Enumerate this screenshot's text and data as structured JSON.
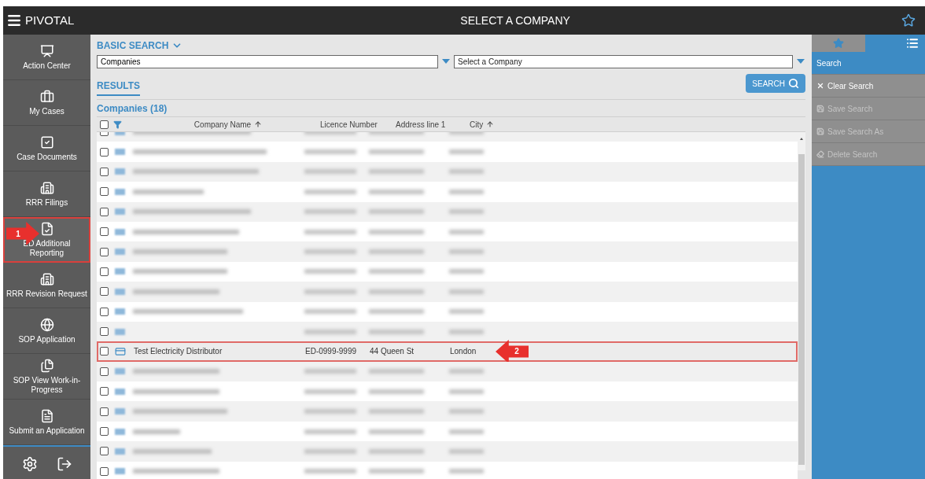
{
  "topbar": {
    "menu_label": "PIVOTAL",
    "title": "SELECT A COMPANY"
  },
  "sidebar": {
    "items": [
      {
        "label": "Action Center",
        "selected": false
      },
      {
        "label": "My Cases",
        "selected": false
      },
      {
        "label": "Case Documents",
        "selected": false
      },
      {
        "label": "RRR Filings",
        "selected": false
      },
      {
        "label": "ED Additional Reporting",
        "selected": true,
        "callout": "1"
      },
      {
        "label": "RRR Revision Request",
        "selected": false
      },
      {
        "label": "SOP Application",
        "selected": false
      },
      {
        "label": "SOP View Work-in-Progress",
        "selected": false
      },
      {
        "label": "Submit an Application",
        "selected": false
      }
    ]
  },
  "search": {
    "heading": "BASIC SEARCH",
    "entity_field": {
      "value": "Companies"
    },
    "company_field": {
      "placeholder": "Select a Company"
    },
    "button": "SEARCH"
  },
  "results": {
    "heading": "RESULTS",
    "count_label": "Companies (18)",
    "select_all_checked": false,
    "columns": [
      {
        "label": "Company Name",
        "sorted": true
      },
      {
        "label": "Licence Number",
        "sorted": false
      },
      {
        "label": "Address line 1",
        "sorted": false
      },
      {
        "label": "City",
        "sorted": true
      }
    ],
    "rows": [
      {
        "kind": "redacted",
        "checked": false
      },
      {
        "kind": "redacted",
        "checked": false
      },
      {
        "kind": "redacted",
        "checked": false
      },
      {
        "kind": "redacted",
        "checked": false
      },
      {
        "kind": "redacted",
        "checked": false
      },
      {
        "kind": "redacted",
        "checked": false
      },
      {
        "kind": "redacted",
        "checked": false
      },
      {
        "kind": "redacted",
        "checked": false
      },
      {
        "kind": "redacted",
        "checked": false
      },
      {
        "kind": "redacted",
        "checked": false
      },
      {
        "kind": "redacted",
        "checked": false
      },
      {
        "kind": "record",
        "checked": false,
        "name": "Test Electricity Distributor",
        "licence": "ED-0999-9999",
        "address": "44 Queen St",
        "city": "London",
        "callout": "2"
      },
      {
        "kind": "redacted",
        "checked": false
      },
      {
        "kind": "redacted",
        "checked": false
      },
      {
        "kind": "redacted",
        "checked": false
      },
      {
        "kind": "redacted",
        "checked": false
      },
      {
        "kind": "redacted",
        "checked": false
      },
      {
        "kind": "redacted",
        "checked": false
      }
    ]
  },
  "right_panel": {
    "tabs": [
      {
        "selected": false
      },
      {
        "selected": true
      }
    ],
    "actions": [
      {
        "label": "Search",
        "selected": true,
        "disabled": false
      },
      {
        "label": "Clear Search",
        "selected": false,
        "disabled": false
      },
      {
        "label": "Save Search",
        "selected": false,
        "disabled": true
      },
      {
        "label": "Save Search As",
        "selected": false,
        "disabled": true
      },
      {
        "label": "Delete Search",
        "selected": false,
        "disabled": true
      }
    ]
  }
}
